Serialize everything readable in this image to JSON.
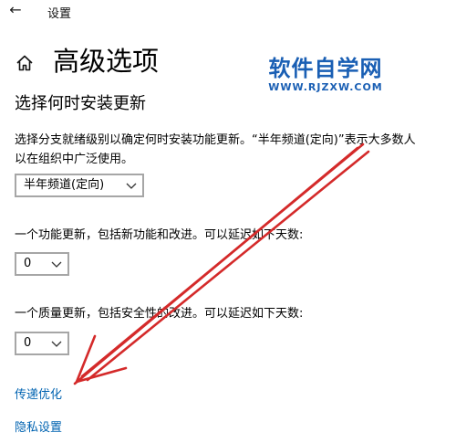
{
  "window": {
    "title": "设置",
    "back_glyph": "←"
  },
  "page": {
    "title": "高级选项"
  },
  "section": {
    "heading": "选择何时安装更新",
    "description_line1": "选择分支就绪级别以确定何时安装功能更新。“半年频道(定向)”表示大多数人",
    "description_line2": "以在组织中广泛使用。"
  },
  "branch_select": {
    "value": "半年频道(定向)"
  },
  "feature_update": {
    "label": "一个功能更新，包括新功能和改进。可以延迟如下天数:",
    "value": "0"
  },
  "quality_update": {
    "label": "一个质量更新，包括安全性的改进。可以延迟如下天数:",
    "value": "0"
  },
  "links": {
    "delivery_optimization": "传递优化",
    "privacy_settings": "隐私设置"
  },
  "watermark": {
    "name": "软件自学网",
    "url": "WWW.RJZXW.COM"
  },
  "colors": {
    "accent_link": "#0063b1",
    "annotation_arrow": "#d42a2a",
    "watermark": "#1a5fb4"
  },
  "icons": {
    "back": "back-arrow-icon",
    "home": "home-icon",
    "dropdown": "chevron-down-icon",
    "annotation": "red-arrow-annotation"
  }
}
